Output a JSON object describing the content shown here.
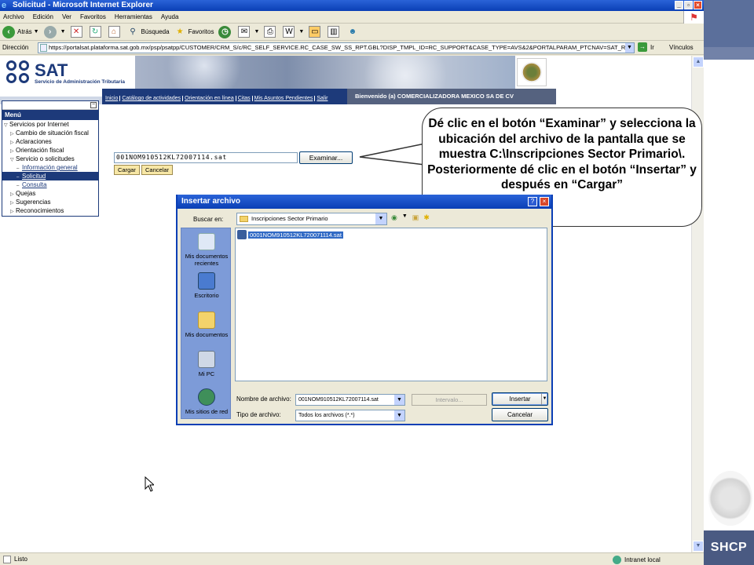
{
  "window": {
    "title": "Solicitud - Microsoft Internet Explorer",
    "controls": [
      "_",
      "▫",
      "×"
    ]
  },
  "menubar": [
    "Archivo",
    "Edición",
    "Ver",
    "Favoritos",
    "Herramientas",
    "Ayuda"
  ],
  "toolbar": {
    "back": "Atrás",
    "search": "Búsqueda",
    "favorites": "Favoritos"
  },
  "address": {
    "label": "Dirección",
    "url": "https://portalsat.plataforma.sat.gob.mx/psp/psatpp/CUSTOMER/CRM_S/c/RC_SELF_SERVICE.RC_CASE_SW_SS_RPT.GBL?DISP_TMPL_ID=RC_SUPPORT&CASE_TYPE=AVS&2&PORTALPARAM_PTCNAV=SAT_RC_CASE_SW",
    "go": "Ir",
    "links": "Vínculos"
  },
  "sat": {
    "brand": "SAT",
    "subtitle": "Servicio de Administración Tributaria"
  },
  "nav": {
    "links": [
      "Inicio",
      "Catálogo de actividades",
      "Orientación en línea",
      "Citas",
      "Mis Asuntos Pendientes",
      "Salir"
    ],
    "welcome": "Bienvenido (a)  COMERCIALIZADORA MEXICO SA DE CV"
  },
  "menu": {
    "minimize": "−",
    "title": "Menú",
    "items": [
      {
        "label": "Servicios por Internet",
        "marker": "▽"
      },
      {
        "label": "Cambio de situación fiscal",
        "marker": "▷"
      },
      {
        "label": "Aclaraciones",
        "marker": "▷"
      },
      {
        "label": "Orientación fiscal",
        "marker": "▷"
      },
      {
        "label": "Servicio o solicitudes",
        "marker": "▽"
      },
      {
        "label": "Información general",
        "marker": "–"
      },
      {
        "label": "Solicitud",
        "marker": "–"
      },
      {
        "label": "Consulta",
        "marker": "–"
      },
      {
        "label": "Quejas",
        "marker": "▷"
      },
      {
        "label": "Sugerencias",
        "marker": "▷"
      },
      {
        "label": "Reconocimientos",
        "marker": "▷"
      }
    ]
  },
  "form": {
    "file_value": "001NOM910512KL72007114.sat",
    "browse": "Examinar...",
    "upload": "Cargar",
    "cancel": "Cancelar"
  },
  "callout": {
    "text": "Dé clic en el botón “Examinar” y selecciona la ubicación del archivo de la pantalla que se muestra C:\\Inscripciones Sector Primario\\. Posteriormente dé clic en el botón “Insertar” y después en “Cargar”"
  },
  "dialog": {
    "title": "Insertar archivo",
    "help": "?",
    "close": "×",
    "look_in_label": "Buscar en:",
    "look_in_value": "Inscripciones Sector Primario",
    "places": [
      "Mis documentos recientes",
      "Escritorio",
      "Mis documentos",
      "Mi PC",
      "Mis sitios de red"
    ],
    "file": "0001NOM910512KL720071114.sat",
    "filename_label": "Nombre de archivo:",
    "filename_value": "001NOM910512KL72007114.sat",
    "filetype_label": "Tipo de archivo:",
    "filetype_value": "Todos los archivos (*.*)",
    "range": "Intervalo...",
    "insert": "Insertar",
    "cancel": "Cancelar"
  },
  "status": {
    "text": "Listo",
    "zone": "Intranet local"
  },
  "side": {
    "brand": "SHCP"
  }
}
